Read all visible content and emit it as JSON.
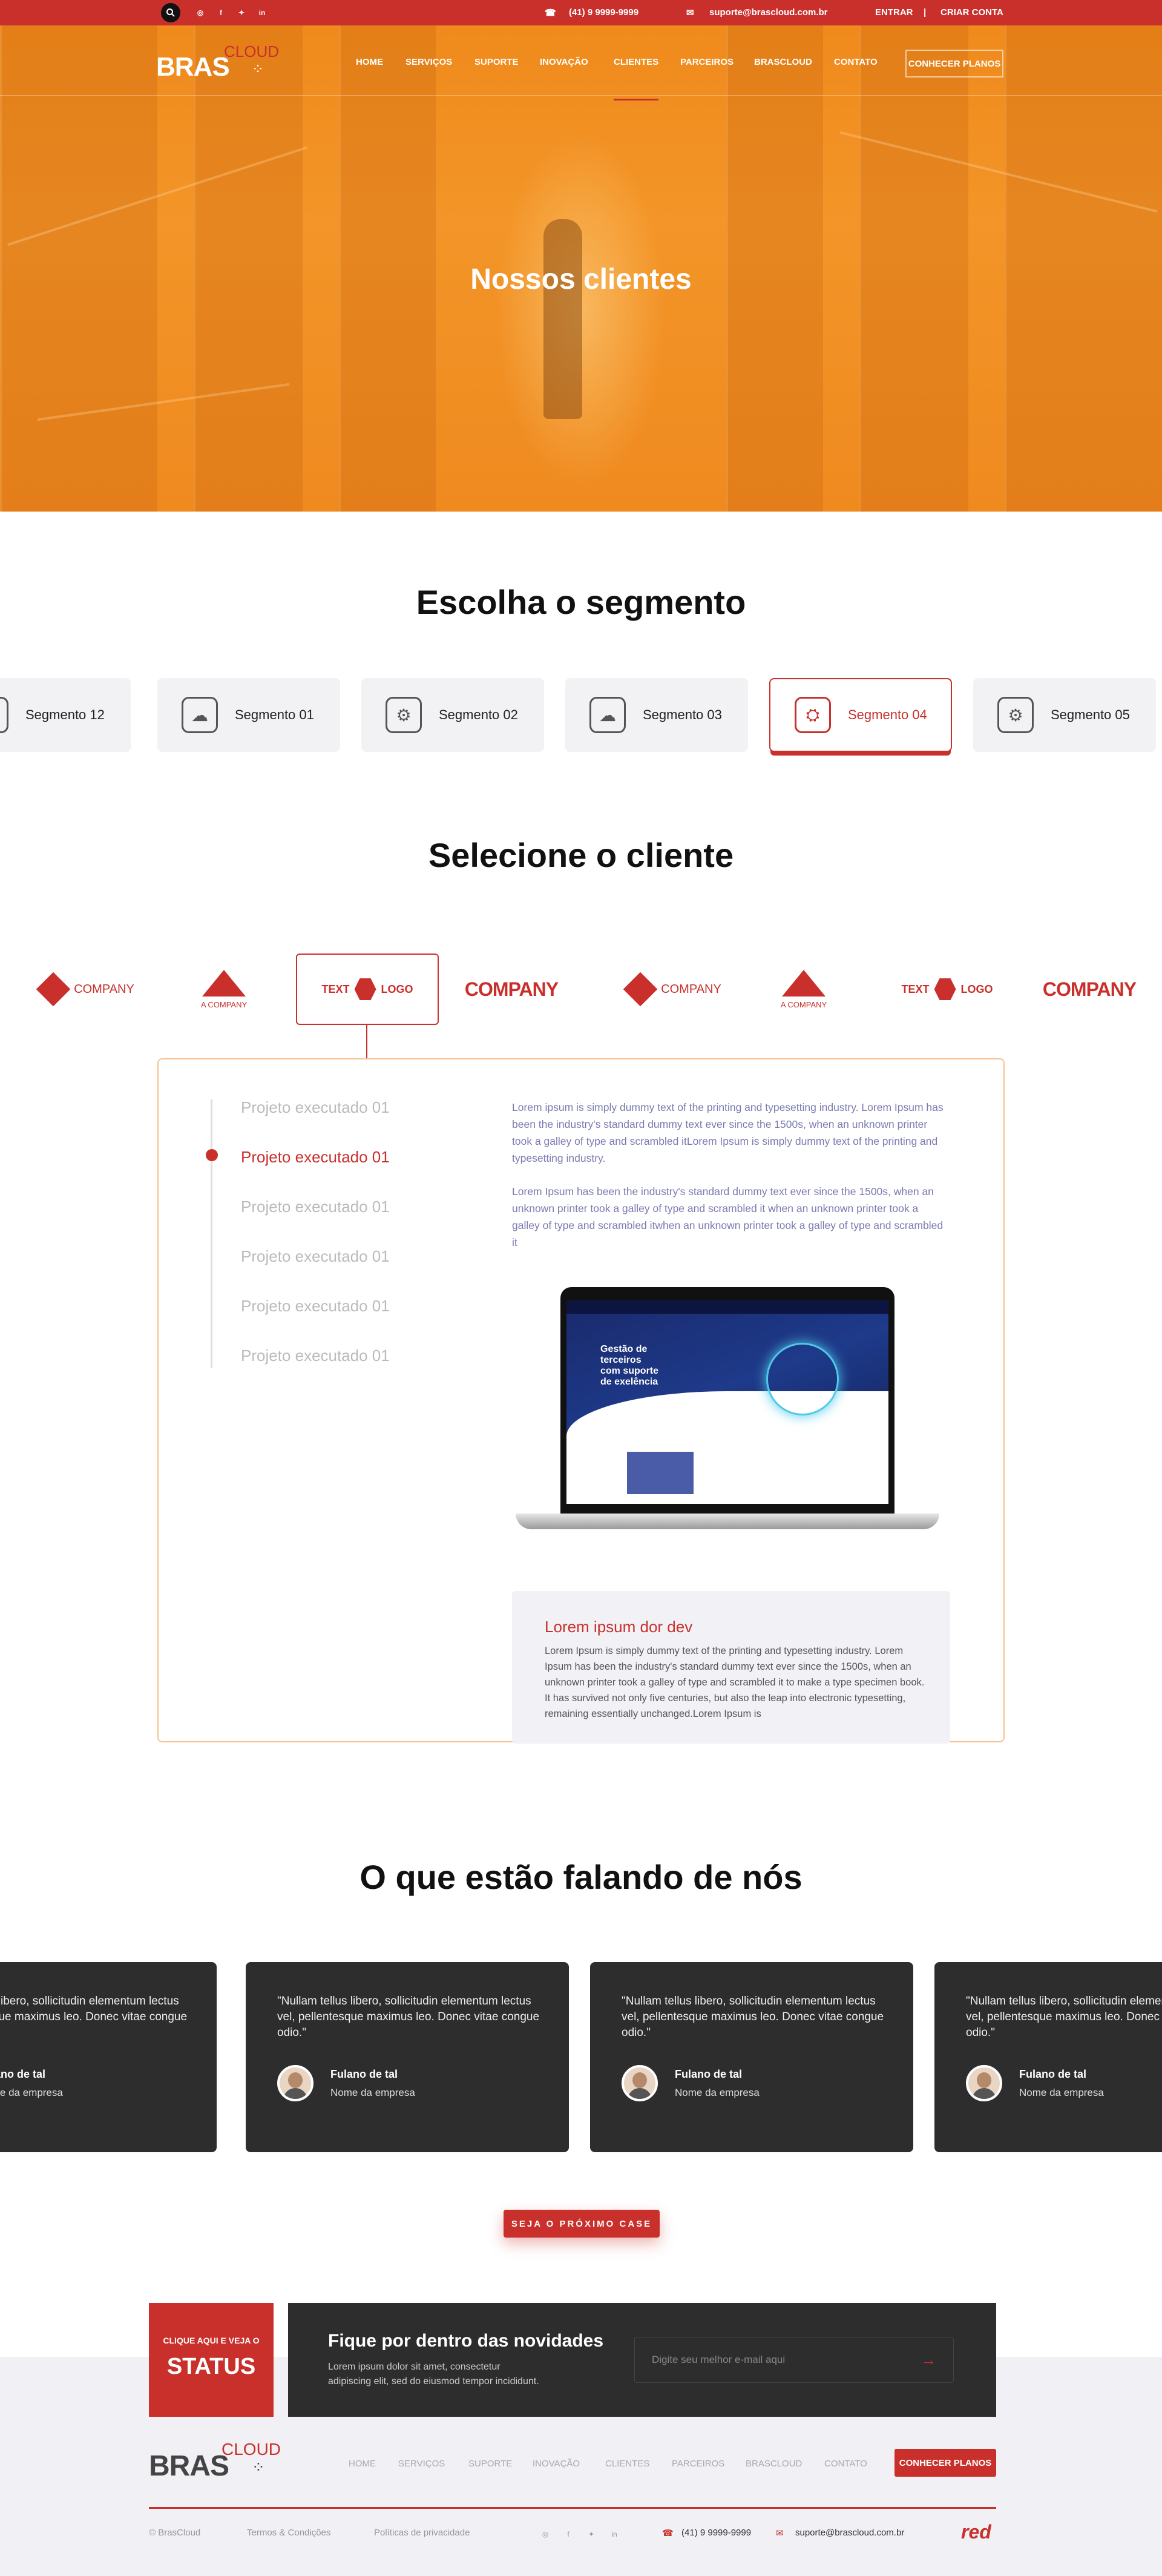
{
  "topbar": {
    "phone": "(41) 9 9999-9999",
    "email": "suporte@brascloud.com.br",
    "login": "ENTRAR",
    "separator": "|",
    "signup": "CRIAR CONTA"
  },
  "brand": {
    "name": "BRAS",
    "sub": "CLOUD"
  },
  "nav": {
    "items": [
      "HOME",
      "SERVIÇOS",
      "SUPORTE",
      "INOVAÇÃO",
      "CLIENTES",
      "PARCEIROS",
      "BRASCLOUD",
      "CONTATO"
    ],
    "active": "CLIENTES",
    "cta": "CONHECER PLANOS"
  },
  "hero": {
    "title": "Nossos clientes"
  },
  "segments": {
    "title": "Escolha o segmento",
    "items": [
      "Segmento 12",
      "Segmento 01",
      "Segmento 02",
      "Segmento 03",
      "Segmento 04",
      "Segmento 05"
    ],
    "active": "Segmento 04"
  },
  "clients": {
    "title": "Selecione o cliente",
    "logos": [
      {
        "text": "COMPANY",
        "style": "diamond"
      },
      {
        "text": "A COMPANY",
        "style": "triangle"
      },
      {
        "text": "TEXT LOGO",
        "style": "hexagon"
      },
      {
        "text": "COMPANY",
        "style": "wordmark"
      },
      {
        "text": "COMPANY",
        "style": "diamond"
      },
      {
        "text": "A COMPANY",
        "style": "triangle"
      },
      {
        "text": "TEXT LOGO",
        "style": "hexagon"
      },
      {
        "text": "COMPANY",
        "style": "wordmark"
      }
    ],
    "text_logo_parts": {
      "text": "TEXT",
      "logo": "LOGO"
    },
    "active_index": 2
  },
  "projects": {
    "items": [
      "Projeto executado 01",
      "Projeto executado 01",
      "Projeto executado 01",
      "Projeto executado 01",
      "Projeto executado 01",
      "Projeto executado 01"
    ],
    "active_index": 1,
    "paragraph1": "Lorem ipsum is simply dummy text of the printing and typesetting industry. Lorem Ipsum has been the industry's standard dummy text ever since the 1500s, when an unknown printer took a galley of type and scrambled itLorem Ipsum is simply dummy text of the printing and typesetting industry.",
    "paragraph2": "Lorem Ipsum has been the industry's standard dummy text ever since the 1500s, when an unknown printer took a galley of type and scrambled it when an unknown printer took a galley of type and scrambled itwhen an unknown printer took a galley of type and scrambled it",
    "laptop_headline": [
      "Gestão de",
      "terceiros",
      "com suporte",
      "de exelência"
    ],
    "box_title": "Lorem ipsum dor dev",
    "box_text": "Lorem Ipsum is simply dummy text of the printing and typesetting industry. Lorem Ipsum has been the industry's standard dummy text ever since the 1500s, when an unknown printer took a galley of type and scrambled it to make a type specimen book. It has survived not only five centuries, but also the leap into electronic typesetting, remaining essentially unchanged.Lorem Ipsum is"
  },
  "testimonials": {
    "title": "O que estão falando de nós",
    "items": [
      {
        "quote": "\"Nullam tellus libero, sollicitudin elementum lectus vel, pellentesque maximus leo. Donec vitae congue odio.\"",
        "name": "Fulano de tal",
        "company": "Nome da empresa"
      },
      {
        "quote": "\"Nullam tellus libero, sollicitudin elementum lectus vel, pellentesque maximus leo. Donec vitae congue odio.\"",
        "name": "Fulano de tal",
        "company": "Nome da empresa"
      },
      {
        "quote": "\"Nullam tellus libero, sollicitudin elementum lectus vel, pellentesque maximus leo. Donec vitae congue odio.\"",
        "name": "Fulano de tal",
        "company": "Nome da empresa"
      },
      {
        "quote": "\"Nullam tellus libero, sollicitudin elementum lectus vel, pellentesque maximus leo. Donec vitae congue odio.\"",
        "name": "Fulano de tal",
        "company": "Nome da empresa"
      }
    ]
  },
  "cta": {
    "label": "SEJA O PRÓXIMO CASE"
  },
  "newsletter": {
    "status_small": "CLIQUE AQUI E VEJA O",
    "status_big": "STATUS",
    "title": "Fique por dentro das novidades",
    "text": "Lorem ipsum dolor sit amet, consectetur adipiscing elit, sed do eiusmod tempor incididunt.",
    "placeholder": "Digite seu melhor e-mail aqui",
    "submit_icon": "arrow-right-icon"
  },
  "footer": {
    "nav": [
      "HOME",
      "SERVIÇOS",
      "SUPORTE",
      "INOVAÇÃO",
      "CLIENTES",
      "PARCEIROS",
      "BRASCLOUD",
      "CONTATO"
    ],
    "cta": "CONHECER PLANOS",
    "copyright": "© BrasCloud",
    "terms": "Termos & Condições",
    "privacy": "Políticas de privacidade",
    "phone": "(41) 9 9999-9999",
    "email": "suporte@brascloud.com.br",
    "credit": "red"
  },
  "colors": {
    "accent": "#c9302c",
    "hero": "#f39528",
    "dark": "#2d2d2d",
    "light": "#f0f0f5"
  }
}
